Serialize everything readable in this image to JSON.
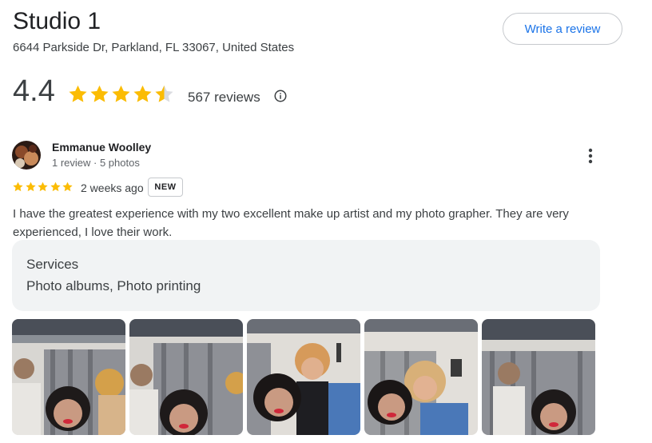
{
  "place": {
    "name": "Studio 1",
    "address": "6644 Parkside Dr, Parkland, FL 33067, United States",
    "write_review_label": "Write a review",
    "rating": "4.4",
    "rating_value": 4.4,
    "review_count": "567 reviews",
    "star_color": "#fbbc04"
  },
  "review": {
    "reviewer_name": "Emmanue Woolley",
    "reviewer_meta": "1 review · 5 photos",
    "rating_value": 5,
    "age": "2 weeks ago",
    "badge": "NEW",
    "text": "I have the greatest experience with my two excellent make up artist and my photo grapher. They are very experienced, I love their work.",
    "services_title": "Services",
    "services_value": "Photo albums, Photo printing",
    "photo_count": 5
  },
  "icons": {
    "info": "info-icon",
    "more": "more-vert-icon",
    "star": "star-icon"
  }
}
